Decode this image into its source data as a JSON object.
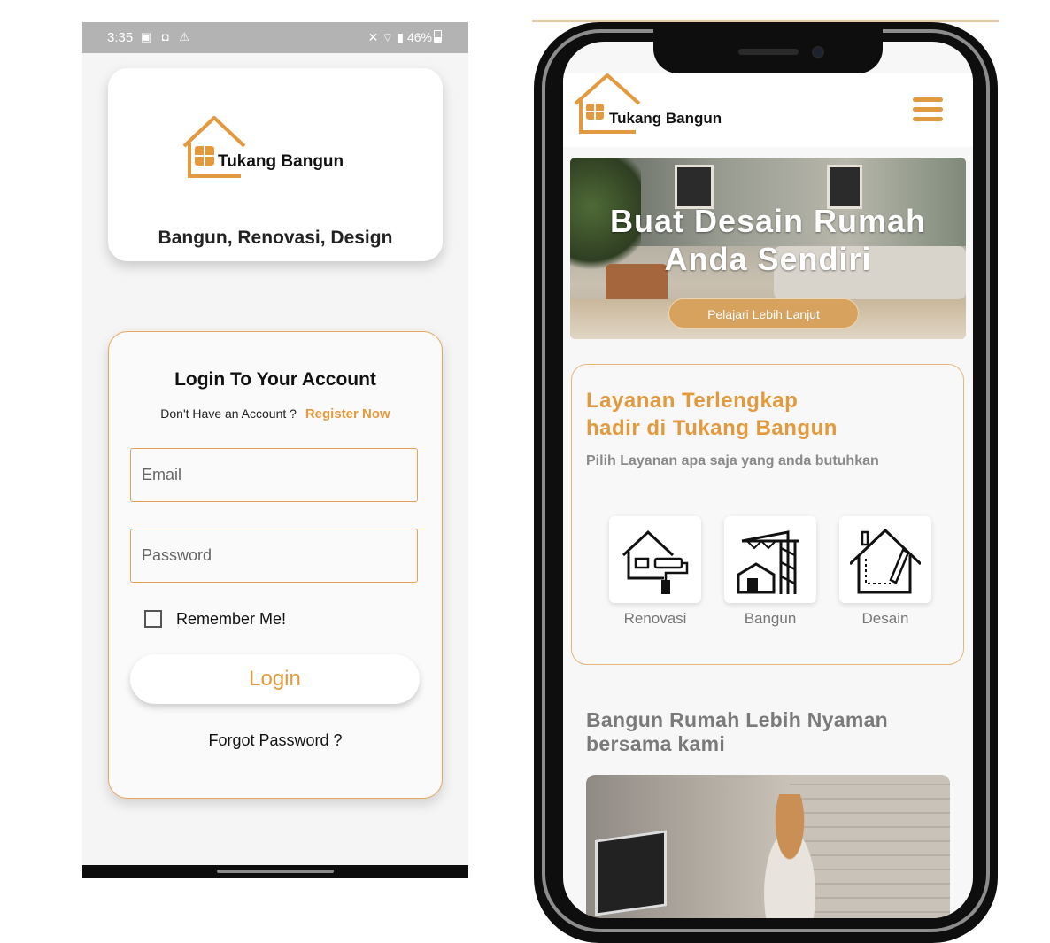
{
  "android": {
    "status_bar": {
      "time": "3:35",
      "battery": "46%"
    },
    "logo_text": "Tukang Bangun",
    "tagline": "Bangun, Renovasi, Design",
    "login": {
      "title": "Login To Your Account",
      "no_account_text": "Don't Have an Account ?",
      "register_link": "Register Now",
      "email_placeholder": "Email",
      "password_placeholder": "Password",
      "remember_label": "Remember Me!",
      "login_button": "Login",
      "forgot_password": "Forgot Password ?"
    }
  },
  "website": {
    "logo_text": "Tukang Bangun",
    "hero": {
      "title_line1": "Buat Desain Rumah",
      "title_line2": "Anda Sendiri",
      "button": "Pelajari Lebih Lanjut"
    },
    "services": {
      "title_line1": "Layanan Terlengkap",
      "title_line2": "hadir di Tukang Bangun",
      "subtitle": "Pilih Layanan apa saja yang anda butuhkan",
      "items": [
        {
          "label": "Renovasi",
          "icon": "house-paint-roller-icon"
        },
        {
          "label": "Bangun",
          "icon": "construction-crane-icon"
        },
        {
          "label": "Desain",
          "icon": "house-pencil-icon"
        }
      ]
    },
    "section2": {
      "title_line1": "Bangun Rumah Lebih Nyaman",
      "title_line2": "bersama kami"
    }
  },
  "colors": {
    "accent": "#e39a3e",
    "card_border": "#e8a861"
  }
}
